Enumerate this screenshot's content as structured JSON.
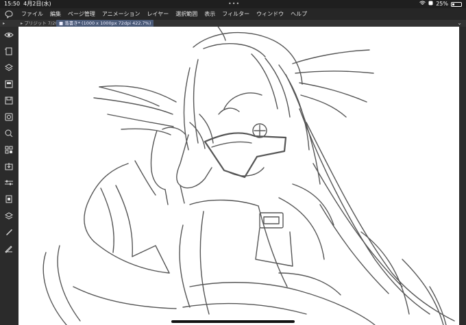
{
  "status": {
    "time": "15:50",
    "date": "4月2日(水)",
    "battery": "25%",
    "battery_level": 0.25
  },
  "menu": {
    "items": [
      "ファイル",
      "編集",
      "ページ管理",
      "アニメーション",
      "レイヤー",
      "選択範囲",
      "表示",
      "フィルター",
      "ウィンドウ",
      "ヘルプ"
    ]
  },
  "tabs": {
    "sub": "プリジット 7/20",
    "active": "落書き* (1000 x 1000px 72dpi 422.7%)"
  },
  "colors": {
    "accent_tab": "#4a5a78",
    "canvas": "#ffffff",
    "ui_dark": "#2b2b2b"
  },
  "toolbar_icons": [
    "eye-icon",
    "frame-icon",
    "brush-stack-icon",
    "layer-icon",
    "save-icon",
    "settings-icon",
    "search-icon",
    "grid-icon",
    "export-icon",
    "sliders-icon",
    "clipboard-icon",
    "layers-icon",
    "pen-icon",
    "pencil-ruler-icon"
  ]
}
